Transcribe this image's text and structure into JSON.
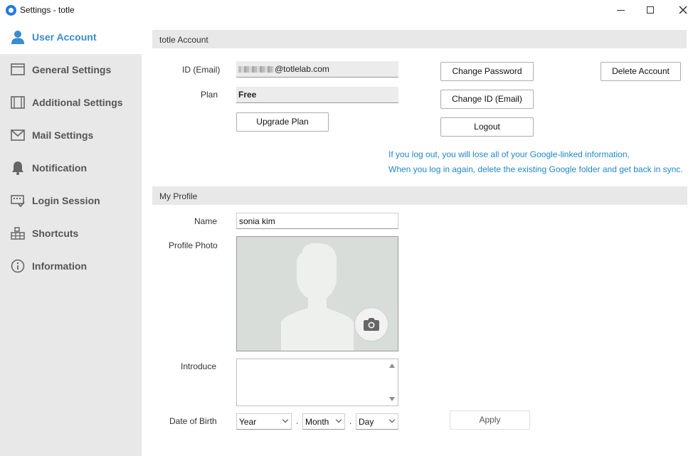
{
  "window": {
    "title": "Settings - totle"
  },
  "sidebar": {
    "items": [
      {
        "label": "User Account",
        "icon": "user-icon",
        "active": true
      },
      {
        "label": "General Settings",
        "icon": "window-icon"
      },
      {
        "label": "Additional Settings",
        "icon": "layout-icon"
      },
      {
        "label": "Mail Settings",
        "icon": "mail-icon"
      },
      {
        "label": "Notification",
        "icon": "bell-icon"
      },
      {
        "label": "Login Session",
        "icon": "session-icon"
      },
      {
        "label": "Shortcuts",
        "icon": "keyboard-icon"
      },
      {
        "label": "Information",
        "icon": "info-icon"
      }
    ]
  },
  "account": {
    "section_title": "totle Account",
    "id_label": "ID (Email)",
    "id_value": "@totlelab.com",
    "plan_label": "Plan",
    "plan_value": "Free",
    "upgrade_label": "Upgrade Plan",
    "change_password_label": "Change Password",
    "change_id_label": "Change ID (Email)",
    "logout_label": "Logout",
    "delete_label": "Delete Account",
    "notice_line1": "If you log out, you will lose all of your Google-linked information,",
    "notice_line2": "When you log in again, delete the existing Google folder and get back in sync."
  },
  "profile": {
    "section_title": "My Profile",
    "name_label": "Name",
    "name_value": "sonia kim",
    "photo_label": "Profile Photo",
    "introduce_label": "Introduce",
    "introduce_value": "",
    "dob_label": "Date of Birth",
    "year_value": "Year",
    "month_value": "Month",
    "day_value": "Day",
    "separator": ".",
    "apply_label": "Apply"
  },
  "colors": {
    "accent": "#3a8bd0",
    "notice": "#1e88c7",
    "sidebar_bg": "#e8e8e8"
  }
}
